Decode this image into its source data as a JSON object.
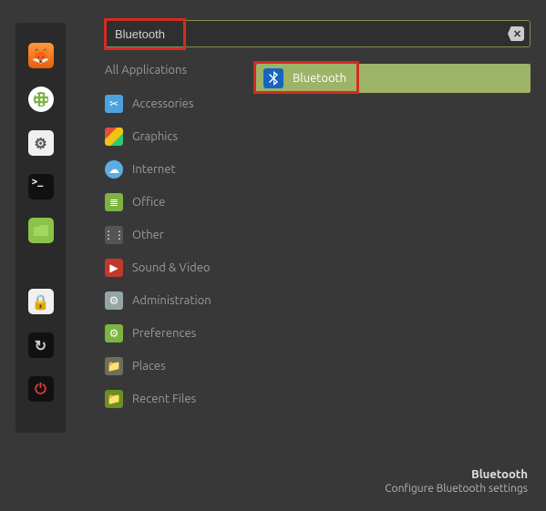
{
  "search": {
    "value": "Bluetooth"
  },
  "sidebar": {
    "firefox": "F",
    "grid": "",
    "settings": "⚙",
    "terminal": ">_",
    "files": "",
    "lock": "🔒",
    "update": "↻",
    "power": "⏻"
  },
  "categories": {
    "all": "All Applications",
    "items": [
      {
        "label": "Accessories",
        "ci": "ci-accessories",
        "glyph": "✂"
      },
      {
        "label": "Graphics",
        "ci": "ci-graphics",
        "glyph": ""
      },
      {
        "label": "Internet",
        "ci": "ci-internet",
        "glyph": "☁"
      },
      {
        "label": "Office",
        "ci": "ci-office",
        "glyph": "≣"
      },
      {
        "label": "Other",
        "ci": "ci-other",
        "glyph": "⋮⋮"
      },
      {
        "label": "Sound & Video",
        "ci": "ci-sound",
        "glyph": "▶"
      },
      {
        "label": "Administration",
        "ci": "ci-admin",
        "glyph": "⚙"
      },
      {
        "label": "Preferences",
        "ci": "ci-prefs",
        "glyph": "⚙"
      },
      {
        "label": "Places",
        "ci": "ci-places",
        "glyph": "📁"
      },
      {
        "label": "Recent Files",
        "ci": "ci-recent",
        "glyph": "📁"
      }
    ]
  },
  "results": [
    {
      "label": "Bluetooth",
      "icon_glyph": "∗"
    }
  ],
  "footer": {
    "title": "Bluetooth",
    "desc": "Configure Bluetooth settings"
  }
}
